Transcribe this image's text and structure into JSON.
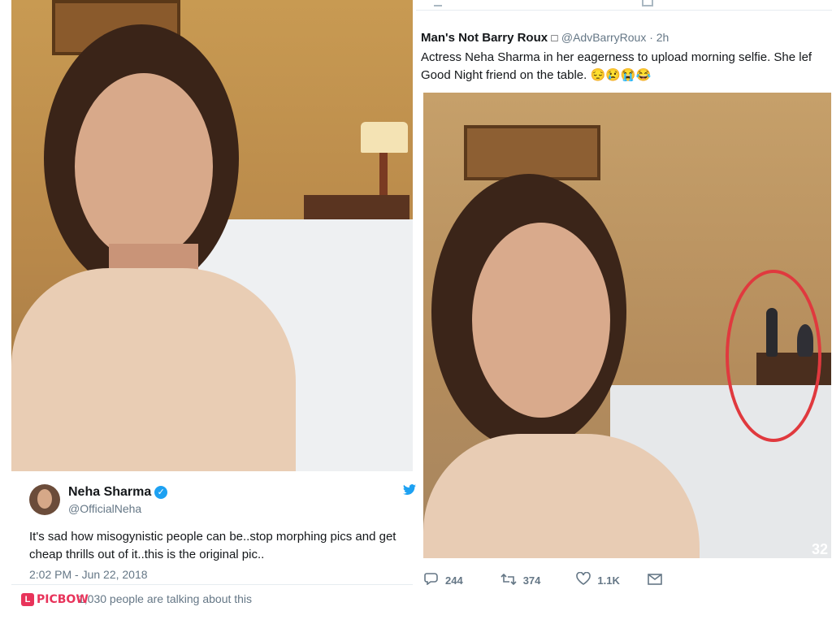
{
  "left_tweet": {
    "name": "Neha Sharma",
    "handle": "@OfficialNeha",
    "text": "It's sad how misogynistic people can be..stop morphing pics and get cheap thrills out of it..this is the original pic..",
    "timestamp": "2:02 PM - Jun 22, 2018",
    "talking": "1,030 people are talking about this"
  },
  "right_tweet": {
    "name": "Man's Not Barry Roux",
    "name_suffix": "□",
    "handle_time": "@AdvBarryRoux · 2h",
    "text_line1": "Actress Neha Sharma in her eagerness to upload morning selfie. She lef",
    "text_line2": "Good Night friend on the table.",
    "emoji_line": "😔😢😭😂",
    "corner_num": "32",
    "replies": "244",
    "retweets": "374",
    "likes": "1.1K"
  },
  "watermark": {
    "text": "PICBOW",
    "badge": "L"
  },
  "colors": {
    "twitter_blue": "#1da1f2",
    "watermark_red": "#e8335a",
    "circle_red": "#e0393e"
  }
}
